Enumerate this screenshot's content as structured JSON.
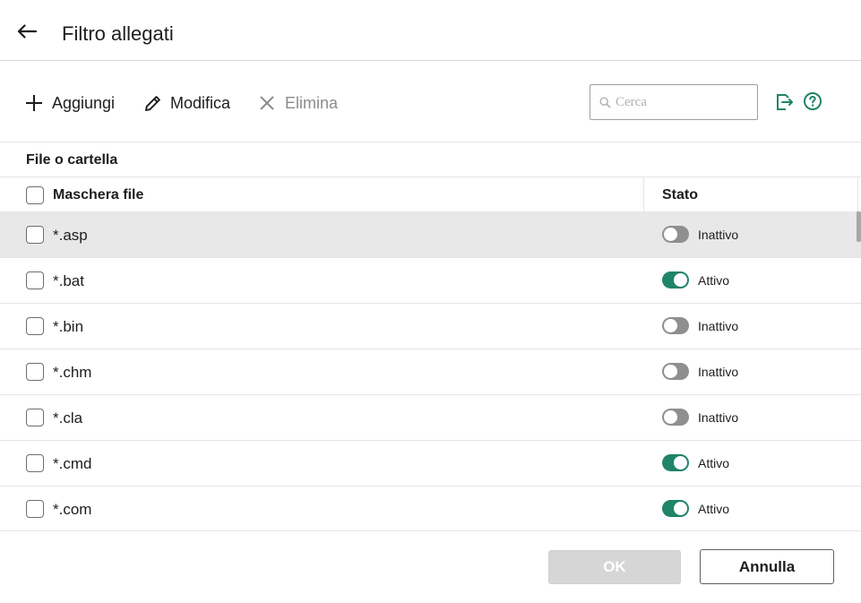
{
  "header": {
    "title": "Filtro allegati",
    "back_icon": "arrow-left-icon"
  },
  "toolbar": {
    "add_label": "Aggiungi",
    "edit_label": "Modifica",
    "delete_label": "Elimina",
    "search_placeholder": "Cerca",
    "search_value": "",
    "export_icon": "export-icon",
    "help_icon": "help-icon"
  },
  "section": {
    "label": "File o cartella"
  },
  "table": {
    "columns": [
      "Maschera file",
      "Stato"
    ],
    "rows": [
      {
        "mask": "*.asp",
        "active": false,
        "state": "Inattivo",
        "selected": true
      },
      {
        "mask": "*.bat",
        "active": true,
        "state": "Attivo",
        "selected": false
      },
      {
        "mask": "*.bin",
        "active": false,
        "state": "Inattivo",
        "selected": false
      },
      {
        "mask": "*.chm",
        "active": false,
        "state": "Inattivo",
        "selected": false
      },
      {
        "mask": "*.cla",
        "active": false,
        "state": "Inattivo",
        "selected": false
      },
      {
        "mask": "*.cmd",
        "active": true,
        "state": "Attivo",
        "selected": false
      },
      {
        "mask": "*.com",
        "active": true,
        "state": "Attivo",
        "selected": false
      }
    ]
  },
  "footer": {
    "ok_label": "OK",
    "cancel_label": "Annulla"
  },
  "colors": {
    "accent": "#1f8468",
    "toggle_off": "#8f8f8f",
    "selected_row": "#e8e8e8"
  }
}
